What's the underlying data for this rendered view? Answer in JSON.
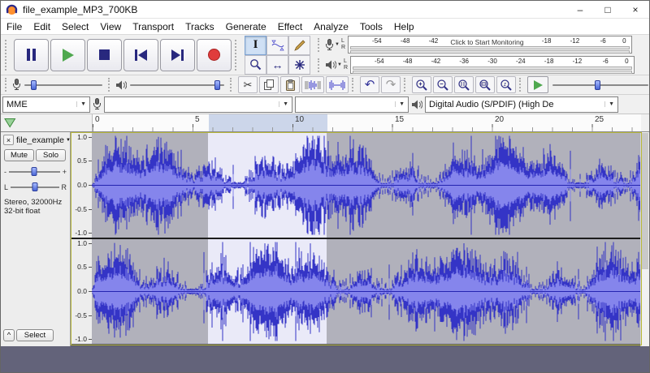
{
  "window": {
    "title": "file_example_MP3_700KB",
    "controls": {
      "minimize": "–",
      "maximize": "□",
      "close": "×"
    }
  },
  "menu": {
    "items": [
      "File",
      "Edit",
      "Select",
      "View",
      "Transport",
      "Tracks",
      "Generate",
      "Effect",
      "Analyze",
      "Tools",
      "Help"
    ]
  },
  "icons": {
    "scissors": "✂",
    "undo": "↶",
    "redo": "↷",
    "ibeam": "I",
    "timeshift": "↔",
    "dropdown": "▼",
    "collapse": "^",
    "track_close": "×"
  },
  "meters": {
    "record": {
      "ticks": [
        "-54",
        "-48",
        "-42"
      ],
      "hint": "Click to Start Monitoring",
      "ticks2": [
        "-18",
        "-12",
        "-6",
        "0"
      ]
    },
    "play": {
      "ticks": [
        "-54",
        "-48",
        "-42",
        "-36",
        "-30",
        "-24",
        "-18",
        "-12",
        "-6",
        "0"
      ]
    }
  },
  "device": {
    "host": "MME",
    "recording": "",
    "channels": "",
    "playback": "Digital Audio (S/PDIF) (High De"
  },
  "timeline": {
    "ticks": [
      "0",
      "5",
      "10",
      "15",
      "20",
      "25"
    ]
  },
  "track": {
    "name": "file_example",
    "mute": "Mute",
    "solo": "Solo",
    "gain_min": "-",
    "gain_max": "+",
    "pan_left": "L",
    "pan_right": "R",
    "info_format": "Stereo, 32000Hz",
    "info_depth": "32-bit float",
    "select": "Select"
  },
  "vruler": [
    "1.0",
    "0.5",
    "0.0",
    "-0.5",
    "-1.0"
  ],
  "colors": {
    "waveform": "#3434c6",
    "waveform_rms": "#8585ec",
    "selection_bg": "#eaeaf8",
    "track_bg": "#b1b1bb",
    "record_red": "#e03c3c",
    "play_green": "#4fa84f"
  }
}
